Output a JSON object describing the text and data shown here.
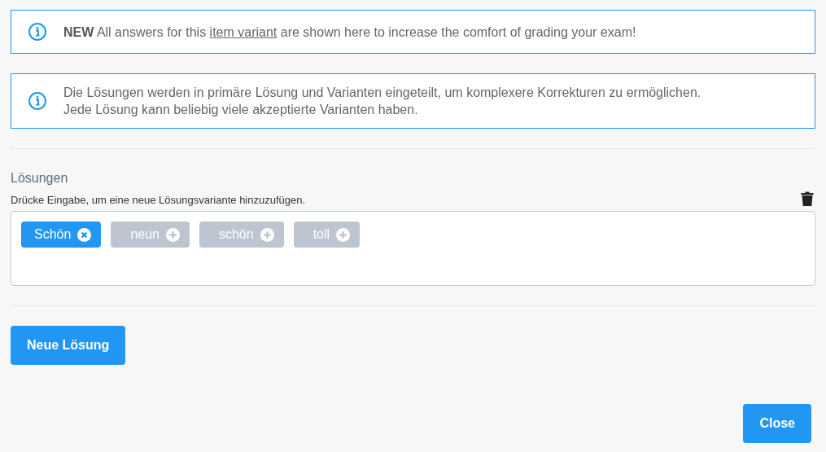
{
  "notices": [
    {
      "badge": "NEW",
      "before": " All answers for this ",
      "link": "item variant",
      "after": " are shown here to increase the comfort of grading your exam!"
    },
    {
      "lines": [
        "Die Lösungen werden in primäre Lösung und Varianten eingeteilt, um komplexere Korrekturen zu ermöglichen.",
        "Jede Lösung kann beliebig viele akzeptierte Varianten haben."
      ]
    }
  ],
  "solutions": {
    "label": "Lösungen",
    "hint": "Drücke Eingabe, um eine neue Lösungsvariante hinzuzufügen.",
    "tags": [
      {
        "text": "Schön",
        "kind": "primary"
      },
      {
        "text": "neun",
        "kind": "variant"
      },
      {
        "text": "schön",
        "kind": "variant"
      },
      {
        "text": "toll",
        "kind": "variant"
      }
    ]
  },
  "new_button": "Neue Lösung",
  "close_button": "Close"
}
